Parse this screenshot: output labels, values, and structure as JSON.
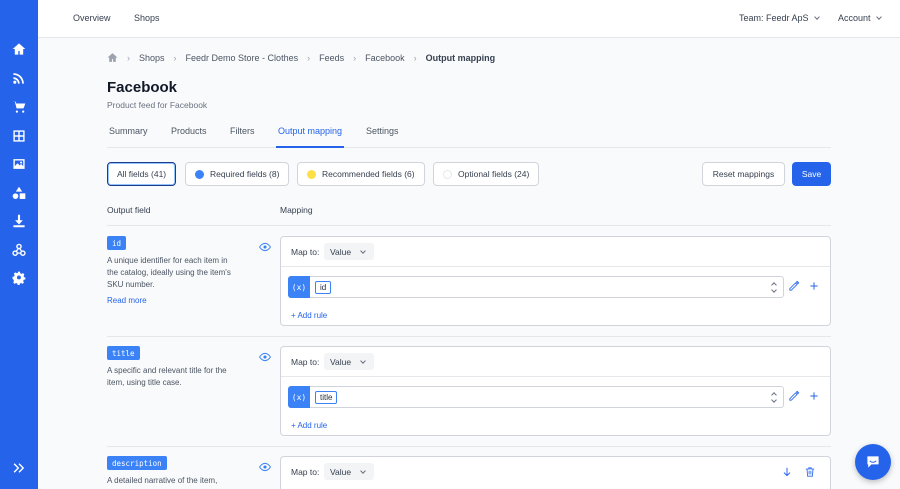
{
  "topbar": {
    "nav": [
      "Overview",
      "Shops"
    ],
    "team_label": "Team: Feedr ApS",
    "account_label": "Account"
  },
  "breadcrumb": {
    "items": [
      "Shops",
      "Feedr Demo Store - Clothes",
      "Feeds",
      "Facebook",
      "Output mapping"
    ]
  },
  "page": {
    "title": "Facebook",
    "subtitle": "Product feed for Facebook"
  },
  "tabs": [
    "Summary",
    "Products",
    "Filters",
    "Output mapping",
    "Settings"
  ],
  "filters": {
    "all": "All fields (41)",
    "required": "Required fields (8)",
    "recommended": "Recommended fields (6)",
    "optional": "Optional fields (24)",
    "colors": {
      "required": "#3b82f6",
      "recommended": "#fde047"
    }
  },
  "actions": {
    "reset": "Reset mappings",
    "save": "Save"
  },
  "columns": {
    "output_field": "Output field",
    "mapping": "Mapping"
  },
  "fields": [
    {
      "tag": "id",
      "desc_lines": [
        "A unique identifier for each item in",
        "the catalog, ideally using the item's",
        "SKU number."
      ],
      "read_more": "Read more",
      "map_label": "Map to:",
      "map_value": "Value",
      "var_symbol": "(x)",
      "var_value": "id",
      "add_rule": "+ Add rule"
    },
    {
      "tag": "title",
      "desc_lines": [
        "A specific and relevant title for the",
        "item, using title case."
      ],
      "map_label": "Map to:",
      "map_value": "Value",
      "var_symbol": "(x)",
      "var_value": "title",
      "add_rule": "+ Add rule"
    },
    {
      "tag": "description",
      "desc_lines": [
        "A detailed narrative of the item,"
      ],
      "map_label": "Map to:",
      "map_value": "Value"
    }
  ],
  "icons": {
    "sidebar": [
      "home-icon",
      "rss-icon",
      "cart-icon",
      "palette-icon",
      "image-icon",
      "shapes-icon",
      "download-icon",
      "webhook-icon",
      "gear-icon"
    ],
    "sidebar_bottom": "expand-icon",
    "chat": "chat-icon"
  },
  "accent": "#2563eb"
}
